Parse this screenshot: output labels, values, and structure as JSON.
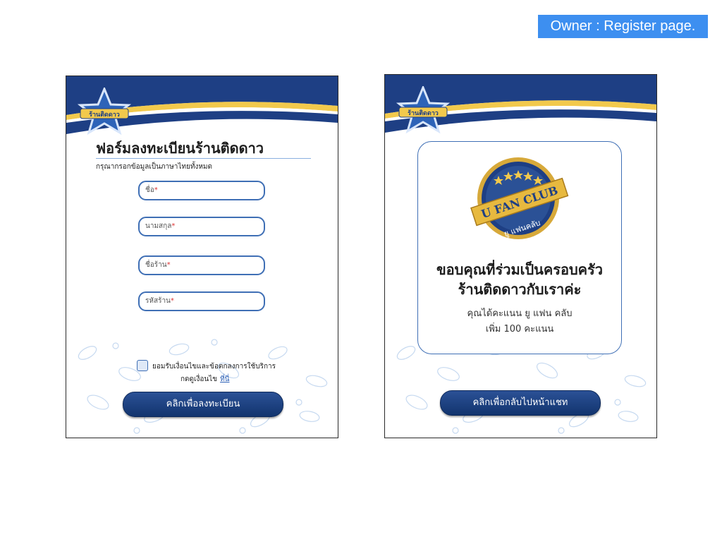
{
  "owner_tag": "Owner : Register page.",
  "brand": {
    "logo_text": "ร้านติดดาว"
  },
  "register": {
    "title": "ฟอร์มลงทะเบียนร้านติดดาว",
    "subtitle": "กรุณากรอกข้อมูลเป็นภาษาไทยทั้งหมด",
    "fields": [
      {
        "placeholder": "ชื่อ"
      },
      {
        "placeholder": "นามสกุล"
      },
      {
        "placeholder": "ชื่อร้าน"
      },
      {
        "placeholder": "รหัสร้าน"
      }
    ],
    "required_mark": "*",
    "terms_label": "ยอมรับเงื่อนไขและข้อตกลงการใช้บริการ",
    "terms_view_prefix": "กดดูเงื่อนไข",
    "terms_link": "ที่นี่",
    "submit_label": "คลิกเพื่อลงทะเบียน"
  },
  "success": {
    "badge_text": "U FAN CLUB",
    "badge_subtext": "ยู แฟนคลับ",
    "thanks_line1": "ขอบคุณที่ร่วมเป็นครอบครัว",
    "thanks_line2": "ร้านติดดาวกับเราค่ะ",
    "points_line1": "คุณได้คะแนน ยู แฟน คลับ",
    "points_line2": "เพิ่ม 100 คะแนน",
    "back_label": "คลิกเพื่อกลับไปหน้าแชท"
  },
  "colors": {
    "navy": "#1e3f84",
    "gold": "#f2c94c",
    "accent_blue": "#3d8ff0",
    "field_border": "#3f6fb5"
  },
  "icons": [
    "star-logo-icon",
    "fan-club-badge-icon",
    "leaf-pattern"
  ]
}
